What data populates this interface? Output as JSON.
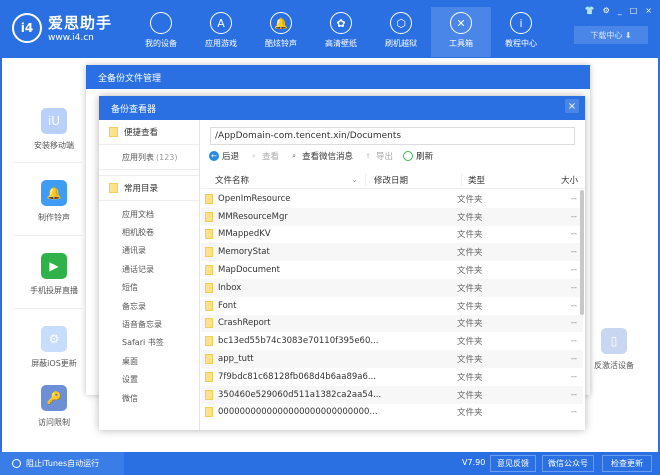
{
  "app": {
    "name": "爱思助手",
    "url": "www.i4.cn",
    "logo_text": "i4"
  },
  "nav": [
    {
      "label": "我的设备",
      "icon": ""
    },
    {
      "label": "应用游戏",
      "icon": "A"
    },
    {
      "label": "酷炫铃声",
      "icon": "🔔"
    },
    {
      "label": "高清壁纸",
      "icon": "✿"
    },
    {
      "label": "刷机越狱",
      "icon": "⬡"
    },
    {
      "label": "工具箱",
      "icon": "✕"
    },
    {
      "label": "教程中心",
      "icon": "i"
    }
  ],
  "window_controls": [
    "👕",
    "⚙",
    "_",
    "□",
    "×"
  ],
  "download_label": "下载中心 ⬇",
  "tools": [
    {
      "label": "安装移动端",
      "icon": "iU",
      "color": "#b9d0fb"
    },
    {
      "label": "制作铃声",
      "icon": "🔔",
      "color": "#3e9cf5"
    },
    {
      "label": "手机投屏直播",
      "icon": "▶",
      "color": "#2fb24a"
    },
    {
      "label": "屏蔽iOS更新",
      "icon": "⚙",
      "color": "#c8dcfb"
    },
    {
      "label": "访问限制",
      "icon": "🔑",
      "color": "#6d8fd6"
    },
    {
      "label": "反激活设备",
      "icon": "▯",
      "color": "#c8d6f2"
    }
  ],
  "outer_dialog": {
    "title": "全备份文件管理"
  },
  "inner_dialog": {
    "title": "备份查看器",
    "close": "×",
    "sidebar": {
      "quick": "便捷查看",
      "app_list": "应用列表",
      "app_count": "(123)",
      "common": "常用目录",
      "items": [
        "应用文档",
        "相机胶卷",
        "通讯录",
        "通话记录",
        "短信",
        "备忘录",
        "语音备忘录",
        "Safari 书签",
        "桌面",
        "设置",
        "微信"
      ]
    },
    "path": "/AppDomain-com.tencent.xin/Documents",
    "toolbar": {
      "back": "后退",
      "view": "查看",
      "wechat": "查看微信消息",
      "export": "导出",
      "refresh": "刷新"
    },
    "columns": {
      "name": "文件名称",
      "date": "修改日期",
      "type": "类型",
      "size": "大小"
    },
    "rows": [
      {
        "name": "OpenImResource",
        "type": "文件夹",
        "size": "--"
      },
      {
        "name": "MMResourceMgr",
        "type": "文件夹",
        "size": "--"
      },
      {
        "name": "MMappedKV",
        "type": "文件夹",
        "size": "--"
      },
      {
        "name": "MemoryStat",
        "type": "文件夹",
        "size": "--"
      },
      {
        "name": "MapDocument",
        "type": "文件夹",
        "size": "--"
      },
      {
        "name": "Inbox",
        "type": "文件夹",
        "size": "--"
      },
      {
        "name": "Font",
        "type": "文件夹",
        "size": "--"
      },
      {
        "name": "CrashReport",
        "type": "文件夹",
        "size": "--"
      },
      {
        "name": "bc13ed55b74c3083e70110f395e60...",
        "type": "文件夹",
        "size": "--"
      },
      {
        "name": "app_tutt",
        "type": "文件夹",
        "size": "--"
      },
      {
        "name": "7f9bdc81c68128fb068d4b6aa89a6...",
        "type": "文件夹",
        "size": "--"
      },
      {
        "name": "350460e529060d511a1382ca2aa54...",
        "type": "文件夹",
        "size": "--"
      },
      {
        "name": "0000000000000000000000000000...",
        "type": "文件夹",
        "size": "--"
      }
    ]
  },
  "bottom": {
    "itunes": "阻止iTunes自动运行",
    "version": "V7.90",
    "feedback": "意见反馈",
    "wechat": "微信公众号",
    "update": "检查更新"
  }
}
